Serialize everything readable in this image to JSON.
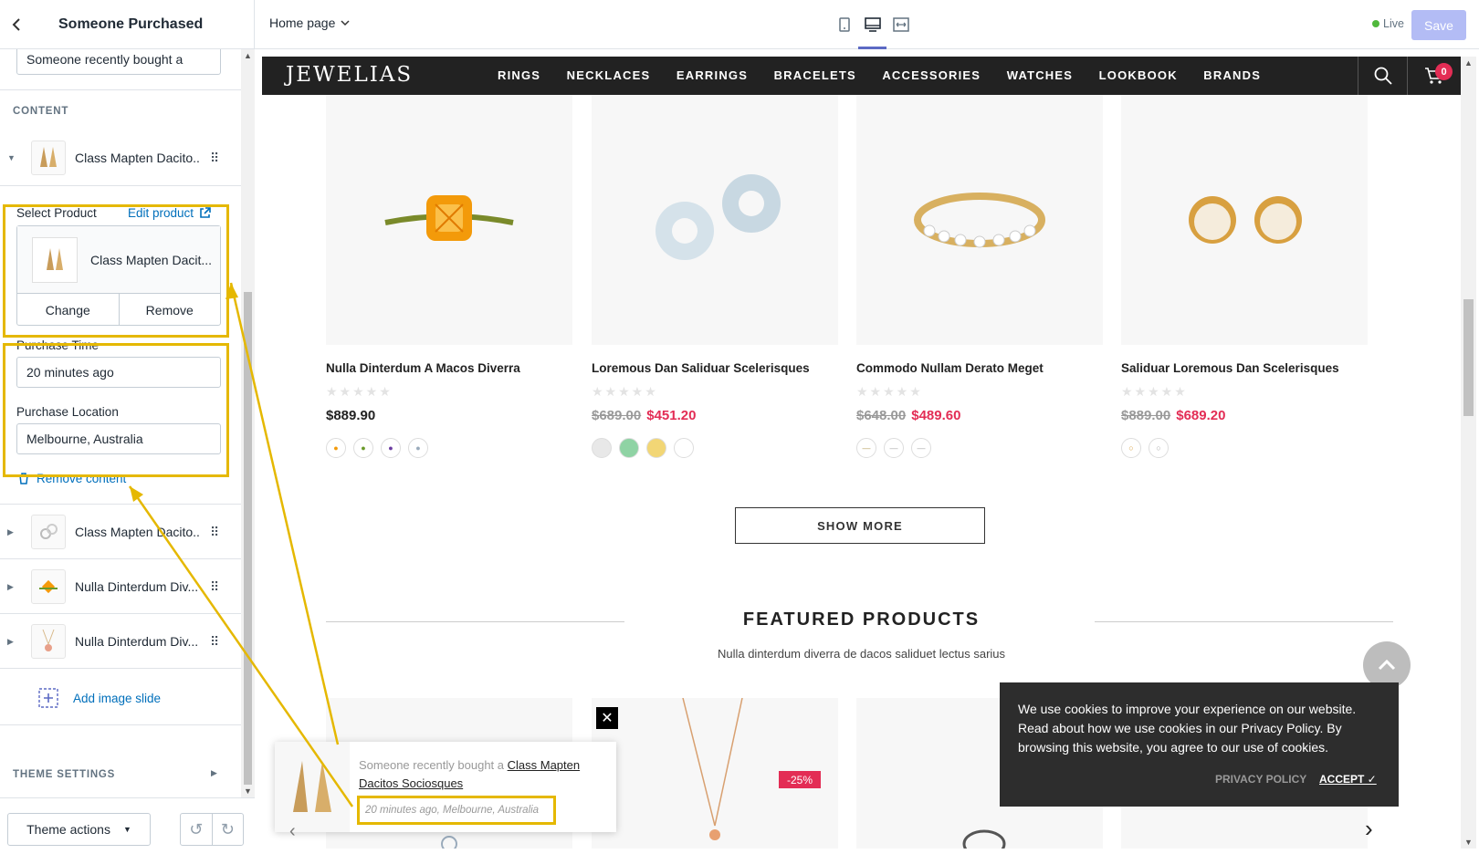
{
  "sidebar": {
    "back_icon": "chevron-left-icon",
    "title": "Someone Purchased",
    "message_field_value": "Someone recently bought a",
    "content_section_label": "CONTENT",
    "active_block_name": "Class Mapten Dacito...",
    "select_product_label": "Select Product",
    "edit_product_label": "Edit product",
    "selected_product_name": "Class Mapten Dacit...",
    "change_label": "Change",
    "remove_label": "Remove",
    "purchase_time_label": "Purchase Time",
    "purchase_time_value": "20 minutes ago",
    "purchase_location_label": "Purchase Location",
    "purchase_location_value": "Melbourne, Australia",
    "remove_content_label": "Remove content",
    "blocks": [
      {
        "name": "Class Mapten Dacito..."
      },
      {
        "name": "Nulla Dinterdum Div..."
      },
      {
        "name": "Nulla Dinterdum Div..."
      }
    ],
    "add_slide_label": "Add image slide",
    "theme_settings_label": "THEME SETTINGS",
    "theme_actions_label": "Theme actions"
  },
  "topbar": {
    "page_select": "Home page",
    "live_label": "Live",
    "save_label": "Save",
    "live_color": "#50b83c",
    "accent_color": "#5c6ac4"
  },
  "store": {
    "logo": "JEWELIAS",
    "nav": [
      "RINGS",
      "NECKLACES",
      "EARRINGS",
      "BRACELETS",
      "ACCESSORIES",
      "WATCHES",
      "LOOKBOOK",
      "BRANDS"
    ],
    "cart_count": "0",
    "products": [
      {
        "title": "Nulla Dinterdum A Macos Diverra",
        "price": "$889.90",
        "old_price": "",
        "sale_price": "",
        "rating": 0
      },
      {
        "title": "Loremous Dan Saliduar Scelerisques",
        "price": "",
        "old_price": "$689.00",
        "sale_price": "$451.20",
        "rating": 0
      },
      {
        "title": "Commodo Nullam Derato Meget",
        "price": "",
        "old_price": "$648.00",
        "sale_price": "$489.60",
        "rating": 0
      },
      {
        "title": "Saliduar Loremous Dan Scelerisques",
        "price": "",
        "old_price": "$889.00",
        "sale_price": "$689.20",
        "rating": 0
      }
    ],
    "show_more": "SHOW MORE",
    "featured_title": "FEATURED PRODUCTS",
    "featured_subtitle": "Nulla dinterdum diverra de dacos saliduet lectus sarius",
    "sale_badge": "-25%",
    "sale_color": "#e32d55"
  },
  "popup": {
    "prefix": "Someone recently bought a",
    "product_link": "Class Mapten Dacitos Sociosques",
    "meta": "20 minutes ago, Melbourne, Australia",
    "close_icon": "close-icon"
  },
  "cookie": {
    "text": "We use cookies to improve your experience on our website. Read about how we use cookies in our Privacy Policy. By browsing this website, you agree to our use of cookies.",
    "privacy_label": "PRIVACY POLICY",
    "accept_label": "ACCEPT ✓"
  }
}
